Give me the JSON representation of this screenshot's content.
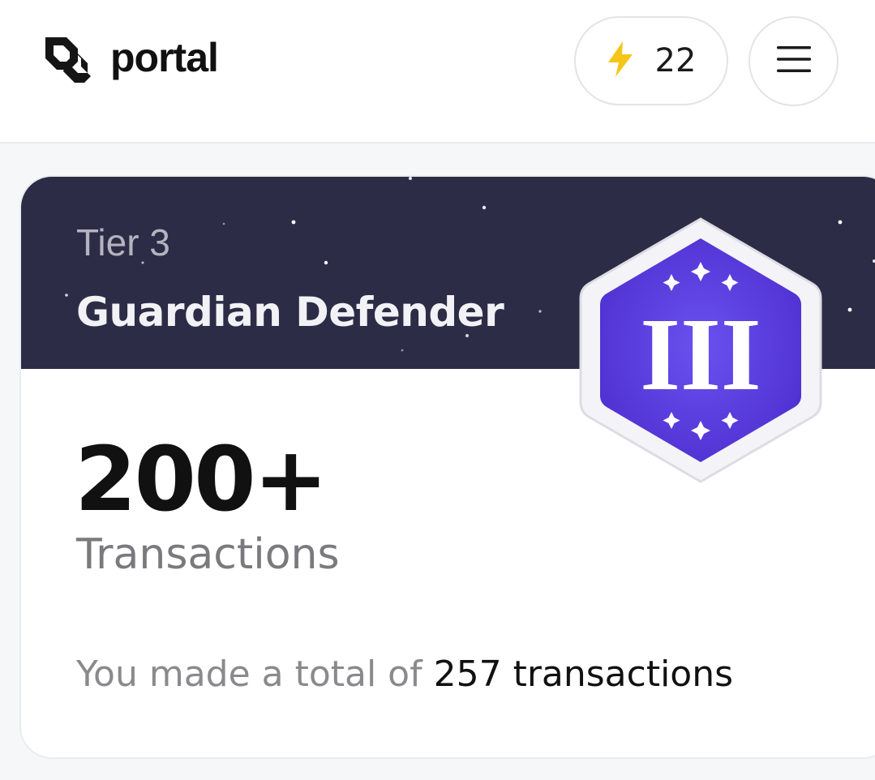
{
  "header": {
    "logo_text": "portal",
    "logo_icon": "portal-logo-icon",
    "points": {
      "icon": "lightning-bolt-icon",
      "value": "22",
      "icon_color": "#f5c518"
    },
    "menu_icon": "hamburger-menu-icon"
  },
  "card": {
    "tier_label": "Tier 3",
    "tier_title": "Guardian Defender",
    "banner_color": "#2c2c46",
    "badge": {
      "numeral": "III",
      "color": "#5b3fd9"
    },
    "count": "200+",
    "count_label": "Transactions",
    "summary_prefix": "You made a total of",
    "summary_value": "257 transactions"
  }
}
